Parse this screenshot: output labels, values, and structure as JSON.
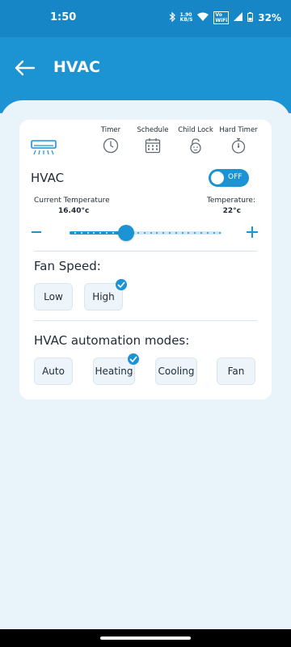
{
  "status_bar": {
    "time": "1:50",
    "speed_value": "1.90",
    "speed_unit": "KB/S",
    "wifi_top": "Vo",
    "wifi_bottom": "WiFi",
    "battery": "32%"
  },
  "app_bar": {
    "title": "HVAC"
  },
  "tools": {
    "timer": "Timer",
    "schedule": "Schedule",
    "child_lock": "Child Lock",
    "hard_timer": "Hard Timer"
  },
  "hvac": {
    "label": "HVAC",
    "toggle_text": "OFF",
    "current_temp_label": "Current Temperature",
    "current_temp_value": "16.40°c",
    "set_temp_label": "Temperature:",
    "set_temp_value": "22°c",
    "slider_fraction": 0.37
  },
  "fan_speed": {
    "title": "Fan Speed:",
    "options": [
      "Low",
      "High"
    ],
    "selected": "High"
  },
  "modes": {
    "title": "HVAC automation modes:",
    "options": [
      "Auto",
      "Heating",
      "Cooling",
      "Fan"
    ],
    "selected": "Heating"
  },
  "colors": {
    "accent": "#1c93d2",
    "status_bar": "#1686c6",
    "background": "#e8f3fa"
  }
}
